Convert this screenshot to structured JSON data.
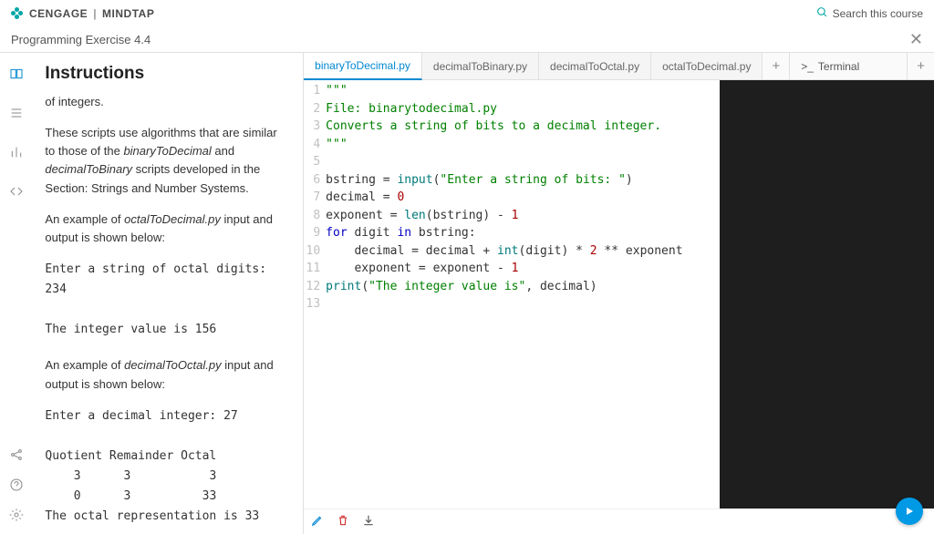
{
  "brand": {
    "name1": "CENGAGE",
    "name2": "MINDTAP"
  },
  "search": {
    "placeholder": "Search this course"
  },
  "page_title": "Programming Exercise 4.4",
  "instructions": {
    "heading": "Instructions",
    "p1": "of integers.",
    "p2a": "These scripts use algorithms that are similar to those of the ",
    "p2em1": "binaryToDecimal",
    "p2b": " and ",
    "p2em2": "decimalToBinary",
    "p2c": " scripts developed in the Section: Strings and Number Systems.",
    "p3a": "An example of ",
    "p3em1": "octalToDecimal.py",
    "p3b": " input and output is shown below:",
    "code1": "Enter a string of octal digits: 234\n\nThe integer value is 156",
    "p4a": "An example of ",
    "p4em1": "decimalToOctal.py",
    "p4b": " input and output is shown below:",
    "code2": "Enter a decimal integer: 27\n\nQuotient Remainder Octal\n    3      3           3\n    0      3          33\nThe octal representation is 33"
  },
  "tabs": {
    "files": [
      "binaryToDecimal.py",
      "decimalToBinary.py",
      "decimalToOctal.py",
      "octalToDecimal.py"
    ],
    "active": 0,
    "plus": "+",
    "terminal_label": "Terminal"
  },
  "code": {
    "lines": [
      [
        {
          "t": "\"\"\"",
          "c": "g"
        }
      ],
      [
        {
          "t": "File: binarytodecimal.py",
          "c": "g"
        }
      ],
      [
        {
          "t": "Converts a string of bits to a decimal integer.",
          "c": "g"
        }
      ],
      [
        {
          "t": "\"\"\"",
          "c": "g"
        }
      ],
      [],
      [
        {
          "t": "bstring = "
        },
        {
          "t": "input",
          "c": "t"
        },
        {
          "t": "("
        },
        {
          "t": "\"Enter a string of bits: \"",
          "c": "g"
        },
        {
          "t": ")"
        }
      ],
      [
        {
          "t": "decimal = "
        },
        {
          "t": "0",
          "c": "r"
        }
      ],
      [
        {
          "t": "exponent = "
        },
        {
          "t": "len",
          "c": "t"
        },
        {
          "t": "(bstring) - "
        },
        {
          "t": "1",
          "c": "r"
        }
      ],
      [
        {
          "t": "for",
          "c": "b"
        },
        {
          "t": " digit "
        },
        {
          "t": "in",
          "c": "b"
        },
        {
          "t": " bstring:"
        }
      ],
      [
        {
          "t": "    decimal = decimal + "
        },
        {
          "t": "int",
          "c": "t"
        },
        {
          "t": "(digit) * "
        },
        {
          "t": "2",
          "c": "r"
        },
        {
          "t": " ** exponent"
        }
      ],
      [
        {
          "t": "    exponent = exponent - "
        },
        {
          "t": "1",
          "c": "r"
        }
      ],
      [
        {
          "t": "print",
          "c": "t"
        },
        {
          "t": "("
        },
        {
          "t": "\"The integer value is\"",
          "c": "g"
        },
        {
          "t": ", decimal)"
        }
      ],
      []
    ]
  }
}
